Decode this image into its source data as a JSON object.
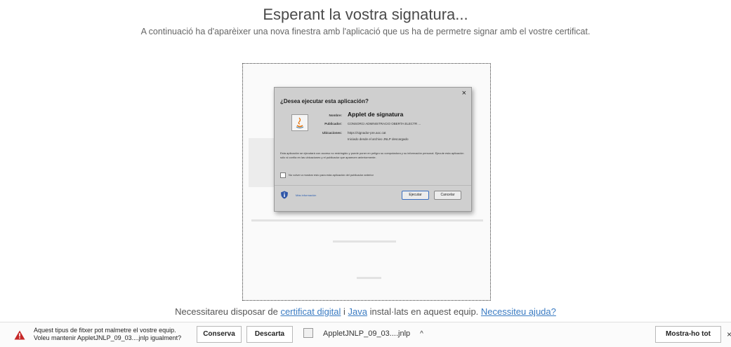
{
  "page": {
    "heading": "Esperant la vostra signatura...",
    "subheading": "A continuació ha d'aparèixer una nova finestra amb l'aplicació que us ha de permetre signar amb el vostre certificat."
  },
  "dialog": {
    "title": "¿Desea ejecutar esta aplicación?",
    "close": "×",
    "name_label": "Nombre:",
    "name_value": "Applet de signatura",
    "publisher_label": "Publicador:",
    "publisher_value": "CONSORCI ADMINISTRACIO OBERTA ELECTR ...",
    "location_label": "Ubicaciones:",
    "location_value": "https://signador-pre.aoc.cat",
    "location_note": "Iniciado desde el archivo JNLP descargado",
    "warning": "Esta aplicación se ejecutará con acceso no restringido y puede poner en peligro su computadora y su información personal. Ejecute esta aplicación sólo si confía en las ubicaciones y el publicador que aparecen anteriormente.",
    "checkbox_label": "No volver a mostrar esto para esta aplicación del publicador anterior",
    "more_info": "Más información",
    "run_button": "Ejecutar",
    "cancel_button": "Cancelar"
  },
  "footer": {
    "text1": "Necessitareu disposar de ",
    "link1": "certificat digital",
    "text2": " i ",
    "link2": "Java",
    "text3": " instal·lats en aquest equip. ",
    "link3": "Necessiteu ajuda?"
  },
  "download_bar": {
    "warning_line1": "Aquest tipus de fitxer pot malmetre el vostre equip.",
    "warning_line2": "Voleu mantenir AppletJNLP_09_03....jnlp igualment?",
    "keep_button": "Conserva",
    "discard_button": "Descarta",
    "file_name": "AppletJNLP_09_03....jnlp",
    "caret": "^",
    "show_all_button": "Mostra-ho tot",
    "close": "×"
  },
  "colors": {
    "link": "#3a7bc2",
    "warning_red": "#c62828",
    "dialog_bg": "#cfcfcf"
  }
}
